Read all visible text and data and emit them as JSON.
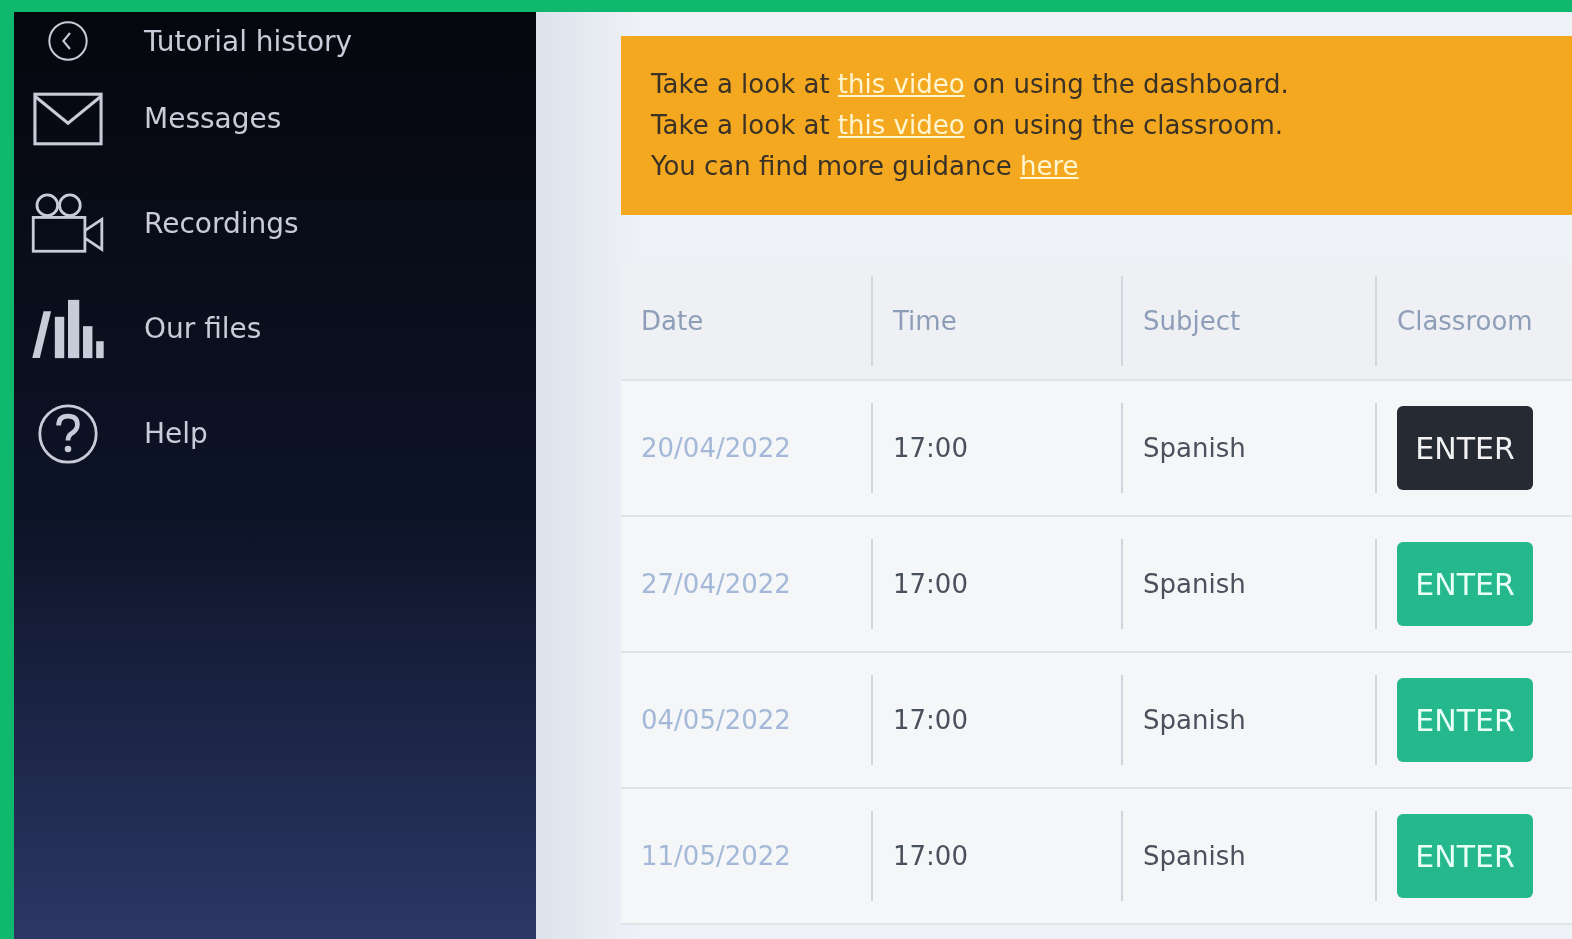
{
  "sidebar": {
    "items": [
      {
        "label": "Tutorial history",
        "kind": "history"
      },
      {
        "label": "Messages",
        "kind": "mail"
      },
      {
        "label": "Recordings",
        "kind": "camera"
      },
      {
        "label": "Our files",
        "kind": "books"
      },
      {
        "label": "Help",
        "kind": "help"
      }
    ]
  },
  "notice": {
    "lines": [
      {
        "before": "Take a look at ",
        "link": "this video",
        "after": " on using the dashboard."
      },
      {
        "before": "Take a look at ",
        "link": "this video",
        "after": " on using the classroom."
      },
      {
        "before": "You can find more guidance ",
        "link": "here"
      }
    ]
  },
  "table": {
    "columns": [
      "Date",
      "Time",
      "Subject",
      "Classroom"
    ],
    "rows": [
      {
        "date": "20/04/2022",
        "time": "17:00",
        "subject": "Spanish",
        "button": "ENTER",
        "hovered": true
      },
      {
        "date": "27/04/2022",
        "time": "17:00",
        "subject": "Spanish",
        "button": "ENTER",
        "hovered": false
      },
      {
        "date": "04/05/2022",
        "time": "17:00",
        "subject": "Spanish",
        "button": "ENTER",
        "hovered": false
      },
      {
        "date": "11/05/2022",
        "time": "17:00",
        "subject": "Spanish",
        "button": "ENTER",
        "hovered": false
      }
    ]
  }
}
